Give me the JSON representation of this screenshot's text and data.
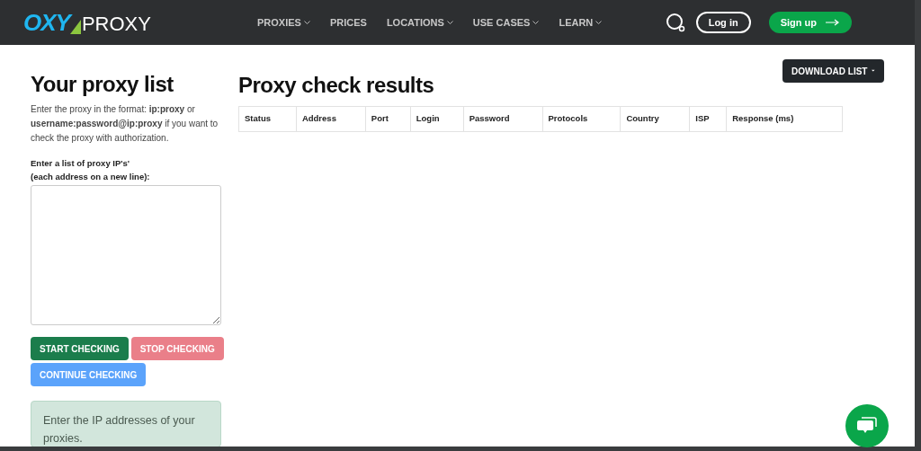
{
  "header": {
    "logo": {
      "mark": "OXY",
      "word": "PROXY"
    },
    "nav": [
      {
        "label": "PROXIES",
        "dropdown": true
      },
      {
        "label": "PRICES",
        "dropdown": false
      },
      {
        "label": "LOCATIONS",
        "dropdown": true
      },
      {
        "label": "USE CASES",
        "dropdown": true
      },
      {
        "label": "LEARN",
        "dropdown": true
      }
    ],
    "login": "Log in",
    "signup": "Sign up"
  },
  "sidebar": {
    "title": "Your proxy list",
    "intro": "Enter the proxy in the format: **ip:proxy** or **username:password@ip:proxy** if you want to check the proxy with authorization.",
    "field_label": "Enter a list of proxy IP's'",
    "field_hint": "(each address on a new line):",
    "buttons": [
      {
        "label": "START CHECKING",
        "kind": "start"
      },
      {
        "label": "STOP CHECKING",
        "kind": "stop"
      },
      {
        "label": "CONTINUE CHECKING",
        "kind": "continue"
      }
    ],
    "notice": "Enter the IP addresses of your proxies."
  },
  "results": {
    "title": "Proxy check results",
    "download": "DOWNLOAD LIST",
    "columns": [
      "Status",
      "Address",
      "Port",
      "Login",
      "Password",
      "Protocols",
      "Country",
      "ISP",
      "Response (ms)"
    ]
  }
}
